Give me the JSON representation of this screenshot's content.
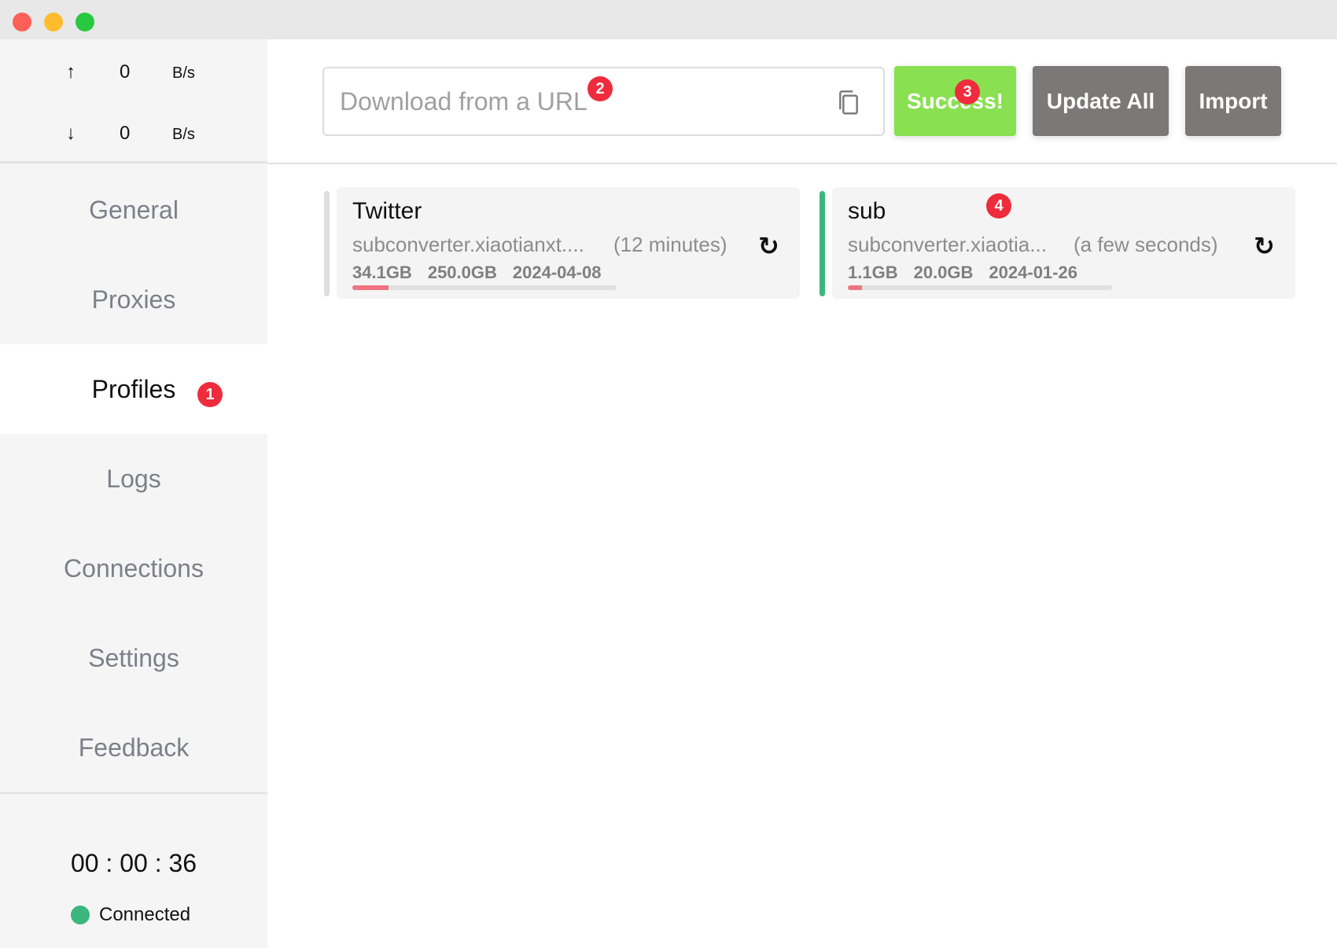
{
  "window": {
    "controls": {
      "close_color": "#fe5f57",
      "minimize_color": "#febc2e",
      "maximize_color": "#28c840"
    }
  },
  "speed": {
    "upload": {
      "icon": "↑",
      "value": "0",
      "unit": "B/s"
    },
    "download": {
      "icon": "↓",
      "value": "0",
      "unit": "B/s"
    }
  },
  "sidebar": {
    "items": [
      {
        "label": "General",
        "active": false
      },
      {
        "label": "Proxies",
        "active": false
      },
      {
        "label": "Profiles",
        "active": true
      },
      {
        "label": "Logs",
        "active": false
      },
      {
        "label": "Connections",
        "active": false
      },
      {
        "label": "Settings",
        "active": false
      },
      {
        "label": "Feedback",
        "active": false
      }
    ],
    "timer": "00 : 00 : 36",
    "status": "Connected",
    "status_color": "#3bb67c"
  },
  "header": {
    "url_placeholder": "Download from a URL",
    "success_label": "Success!",
    "success_color": "#89e050",
    "update_all_label": "Update All",
    "import_label": "Import",
    "button_color": "#7b7877"
  },
  "badges": [
    "1",
    "2",
    "3",
    "4"
  ],
  "profiles": [
    {
      "name": "Twitter",
      "url": "subconverter.xiaotianxt....",
      "updated": "(12 minutes)",
      "used": "34.1GB",
      "total": "250.0GB",
      "expire": "2024-04-08",
      "usage_fraction": 0.136,
      "selected": false
    },
    {
      "name": "sub",
      "url": "subconverter.xiaotia...",
      "updated": "(a few seconds)",
      "used": "1.1GB",
      "total": "20.0GB",
      "expire": "2024-01-26",
      "usage_fraction": 0.055,
      "selected": true
    }
  ]
}
